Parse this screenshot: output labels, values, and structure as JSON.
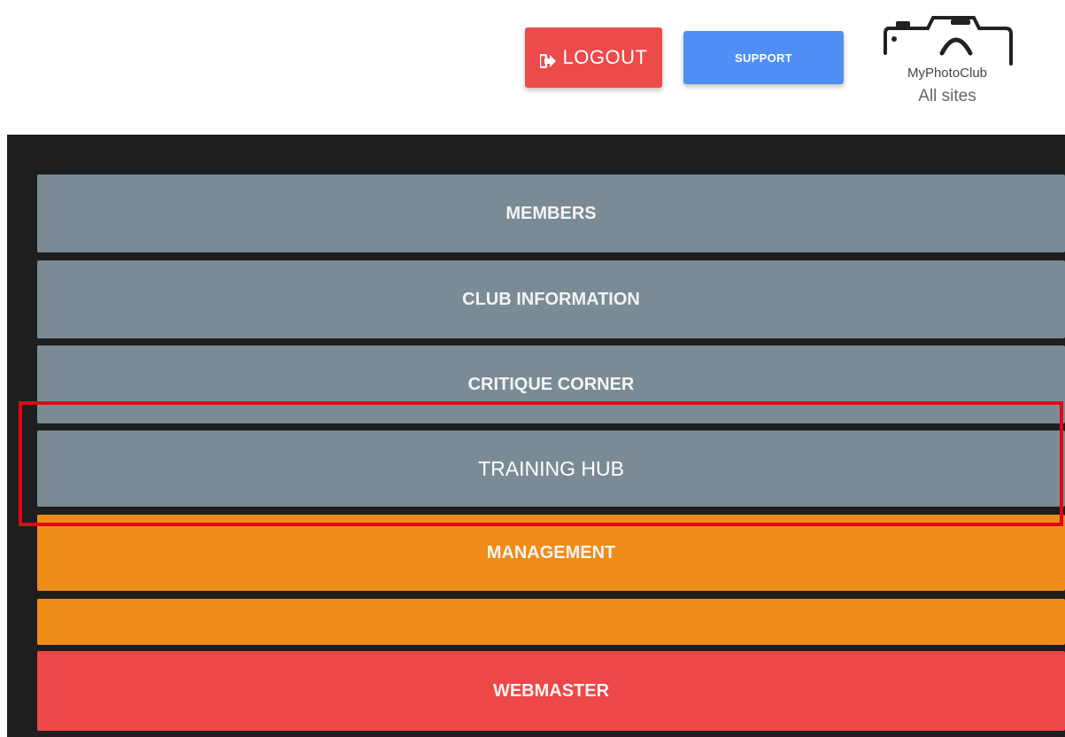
{
  "header": {
    "logout_label": "LOGOUT",
    "logout_icon": "sign-out-icon",
    "support_label": "SUPPORT",
    "logo": {
      "name": "MyPhotoClub",
      "subtitle": "All sites",
      "icon": "camera-icon"
    }
  },
  "menu": {
    "items": [
      {
        "label": "MEMBERS",
        "color": "#7a8b95"
      },
      {
        "label": "CLUB INFORMATION",
        "color": "#7a8b95"
      },
      {
        "label": "CRITIQUE CORNER",
        "color": "#7a8b95"
      },
      {
        "label": "TRAINING HUB",
        "color": "#7a8b95"
      },
      {
        "label": "MANAGEMENT",
        "color": "#ef8c18"
      },
      {
        "label": "",
        "color": "#ef8c18"
      },
      {
        "label": "WEBMASTER",
        "color": "#ee4747"
      }
    ],
    "highlighted_index": 3
  },
  "colors": {
    "logout": "#ec4a4b",
    "support": "#4e8ef5",
    "panel": "#1e1e1e",
    "highlight": "#e30613"
  }
}
